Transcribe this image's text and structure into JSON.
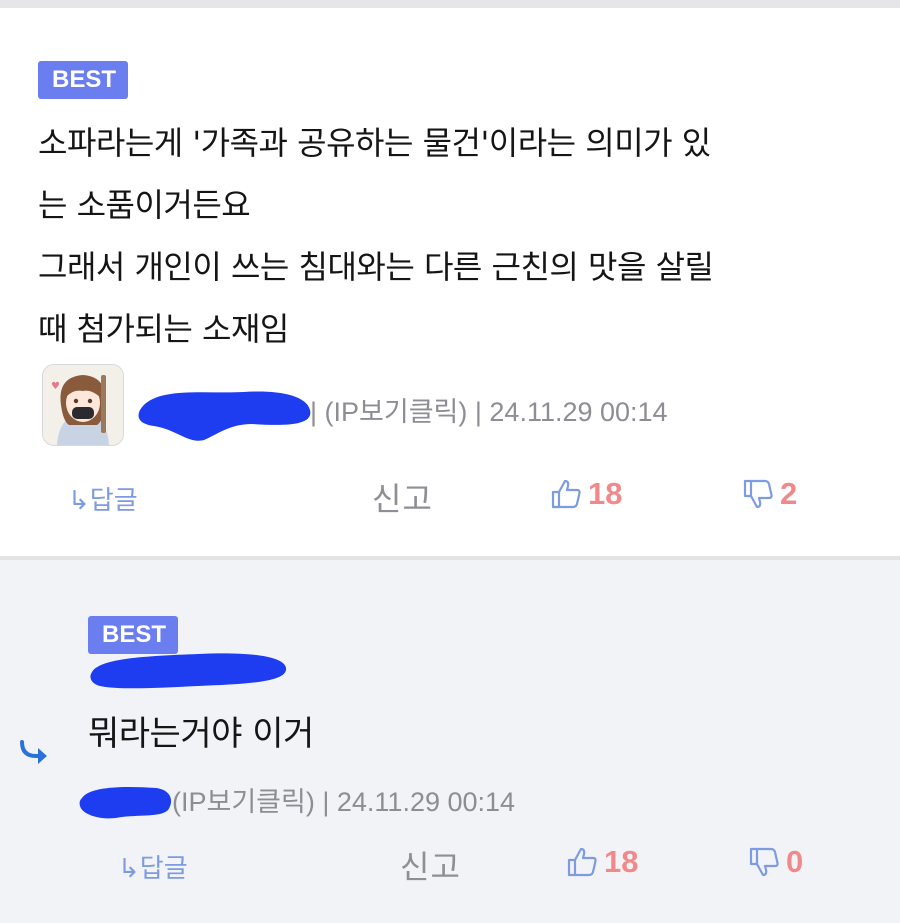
{
  "comments": [
    {
      "badge": "BEST",
      "body_lines": [
        "소파라는게 '가족과 공유하는 물건'이라는 의미가 있",
        "는 소품이거든요",
        "그래서 개인이 쓰는 침대와는 다른 근친의 맛을 살릴",
        "때 첨가되는 소재임"
      ],
      "meta_ip": "| (IP보기클릭)",
      "meta_time": "| 24.11.29 00:14",
      "reply_label": "↳답글",
      "report_label": "신고",
      "likes": "18",
      "dislikes": "2"
    },
    {
      "badge": "BEST",
      "body": "뭐라는거야 이거",
      "meta_ip": "(IP보기클릭)",
      "meta_time": "| 24.11.29 00:14",
      "reply_label": "↳답글",
      "report_label": "신고",
      "likes": "18",
      "dislikes": "0"
    }
  ],
  "colors": {
    "badge": "#6b7ef0",
    "vote_count": "#f08a8a",
    "vote_icon": "#7c9be0",
    "redaction": "#1e3cf0",
    "reply_bg": "#f2f3f7"
  }
}
